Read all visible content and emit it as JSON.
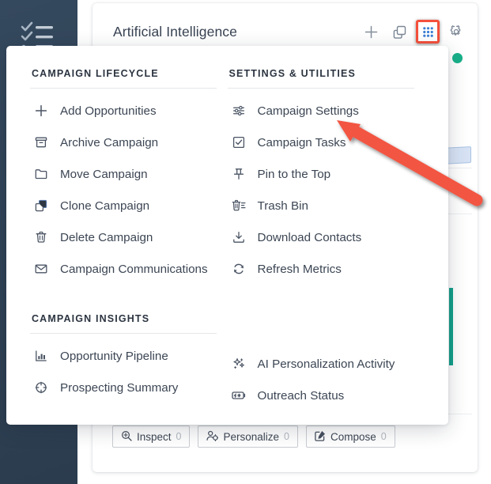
{
  "rail": {
    "icon": "checklist-icon"
  },
  "card": {
    "title": "Artificial Intelligence",
    "header_actions": [
      {
        "name": "add-icon",
        "glyph": "plus"
      },
      {
        "name": "duplicate-icon",
        "glyph": "copy"
      },
      {
        "name": "grid-menu-icon",
        "glyph": "grid-dots",
        "highlighted": true,
        "highlight_color": "#f4503c"
      },
      {
        "name": "gear-icon",
        "glyph": "gear"
      }
    ],
    "decorations": {
      "status_dot_color": "#18b08a",
      "chip_color": "#d7e3f5",
      "accent_bar_color": "#13a08b"
    },
    "chips": [
      {
        "label": "Inspect",
        "count": "0",
        "icon": "magnifier-plus-icon"
      },
      {
        "label": "Personalize",
        "count": "0",
        "icon": "user-gear-icon"
      },
      {
        "label": "Compose",
        "count": "0",
        "icon": "edit-square-icon"
      }
    ]
  },
  "menu": {
    "sections": [
      {
        "title": "CAMPAIGN LIFECYCLE",
        "column": "left",
        "items": [
          {
            "label": "Add Opportunities",
            "icon": "plus-icon"
          },
          {
            "label": "Archive Campaign",
            "icon": "archive-icon"
          },
          {
            "label": "Move Campaign",
            "icon": "folder-icon"
          },
          {
            "label": "Clone Campaign",
            "icon": "clone-icon"
          },
          {
            "label": "Delete Campaign",
            "icon": "trash-icon"
          },
          {
            "label": "Campaign Communications",
            "icon": "envelope-icon"
          }
        ]
      },
      {
        "title": "CAMPAIGN INSIGHTS",
        "column": "left",
        "items": [
          {
            "label": "Opportunity Pipeline",
            "icon": "bar-chart-icon"
          },
          {
            "label": "Prospecting Summary",
            "icon": "crosshair-icon"
          }
        ]
      },
      {
        "title": "SETTINGS & UTILITIES",
        "column": "right",
        "items": [
          {
            "label": "Campaign Settings",
            "icon": "sliders-icon"
          },
          {
            "label": "Campaign Tasks",
            "icon": "checkbox-icon"
          },
          {
            "label": "Pin to the Top",
            "icon": "pin-icon"
          },
          {
            "label": "Trash Bin",
            "icon": "trash-lines-icon"
          },
          {
            "label": "Download Contacts",
            "icon": "download-icon"
          },
          {
            "label": "Refresh Metrics",
            "icon": "refresh-icon"
          }
        ]
      },
      {
        "title": "",
        "column": "right",
        "items": [
          {
            "label": "AI Personalization Activity",
            "icon": "sparkle-icon"
          },
          {
            "label": "Outreach Status",
            "icon": "outreach-icon"
          }
        ]
      }
    ]
  },
  "annotation": {
    "type": "arrow",
    "color": "#f25442",
    "points_to": "Campaign Settings"
  }
}
